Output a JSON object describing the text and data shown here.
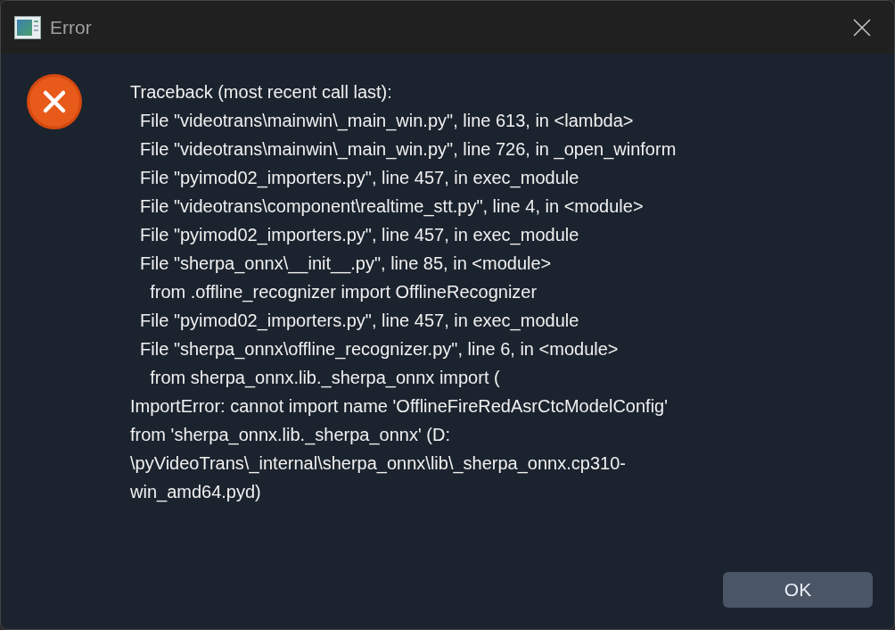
{
  "window": {
    "title": "Error"
  },
  "message": {
    "lines": [
      "Traceback (most recent call last):",
      "  File \"videotrans\\mainwin\\_main_win.py\", line 613, in <lambda>",
      "  File \"videotrans\\mainwin\\_main_win.py\", line 726, in _open_winform",
      "  File \"pyimod02_importers.py\", line 457, in exec_module",
      "  File \"videotrans\\component\\realtime_stt.py\", line 4, in <module>",
      "  File \"pyimod02_importers.py\", line 457, in exec_module",
      "  File \"sherpa_onnx\\__init__.py\", line 85, in <module>",
      "    from .offline_recognizer import OfflineRecognizer",
      "  File \"pyimod02_importers.py\", line 457, in exec_module",
      "  File \"sherpa_onnx\\offline_recognizer.py\", line 6, in <module>",
      "    from sherpa_onnx.lib._sherpa_onnx import (",
      "ImportError: cannot import name 'OfflineFireRedAsrCtcModelConfig'",
      "from 'sherpa_onnx.lib._sherpa_onnx' (D:",
      "\\pyVideoTrans\\_internal\\sherpa_onnx\\lib\\_sherpa_onnx.cp310-",
      "win_amd64.pyd)"
    ]
  },
  "buttons": [
    {
      "label": "OK"
    }
  ]
}
